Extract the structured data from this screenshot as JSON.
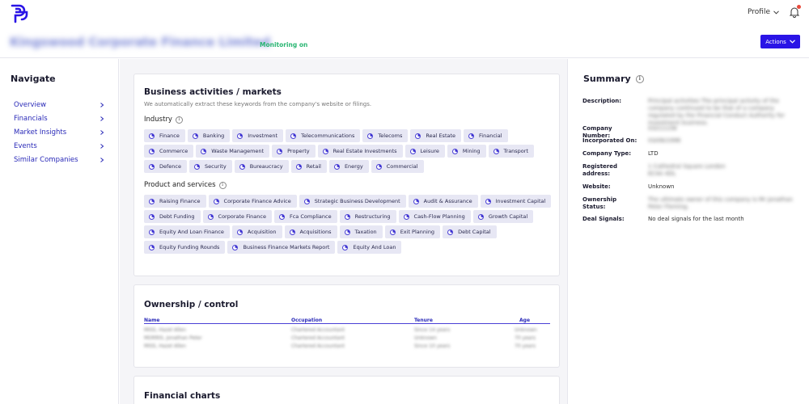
{
  "topbar": {
    "profile_label": "Profile"
  },
  "company": {
    "name": "Kingswood Corporate Finance Limited",
    "monitoring": "Monitoring on",
    "actions_label": "Actions"
  },
  "nav": {
    "title": "Navigate",
    "items": [
      {
        "label": "Overview"
      },
      {
        "label": "Financials"
      },
      {
        "label": "Market Insights"
      },
      {
        "label": "Events"
      },
      {
        "label": "Similar Companies"
      }
    ]
  },
  "business": {
    "title": "Business activities / markets",
    "subtitle": "We automatically extract these keywords from the company's website or filings.",
    "industry_label": "Industry",
    "industry_tags": [
      "Finance",
      "Banking",
      "Investment",
      "Telecommunications",
      "Telecoms",
      "Real Estate",
      "Financial",
      "Commerce",
      "Waste Management",
      "Property",
      "Real Estate Investments",
      "Leisure",
      "Mining",
      "Transport",
      "Defence",
      "Security",
      "Bureaucracy",
      "Retail",
      "Energy",
      "Commercial"
    ],
    "products_label": "Product and services",
    "product_tags": [
      "Raising Finance",
      "Corporate Finance Advice",
      "Strategic Business Development",
      "Audit & Assurance",
      "Investment Capital",
      "Debt Funding",
      "Corporate Finance",
      "Fca Compliance",
      "Restructuring",
      "Cash-Flow Planning",
      "Growth Capital",
      "Equity And Loan Finance",
      "Acquisition",
      "Acquisitions",
      "Taxation",
      "Exit Planning",
      "Debt Capital",
      "Equity Funding Rounds",
      "Business Finance Markets Report",
      "Equity And Loan"
    ]
  },
  "ownership": {
    "title": "Ownership / control",
    "columns": {
      "name": "Name",
      "occupation": "Occupation",
      "tenure": "Tenure",
      "age": "Age"
    },
    "rows": [
      {
        "name": "MISS, Hazel Allen",
        "occupation": "Chartered Accountant",
        "tenure": "Since 14 years",
        "age": "Unknown"
      },
      {
        "name": "MORRIS, Jonathan Peter",
        "occupation": "Chartered Accountant",
        "tenure": "Unknown",
        "age": "70 years"
      },
      {
        "name": "MISS, Hazel Allen",
        "occupation": "Chartered Accountant",
        "tenure": "Since 10 years",
        "age": "70 years"
      }
    ]
  },
  "charts": {
    "title": "Financial charts"
  },
  "summary": {
    "title": "Summary",
    "fields": [
      {
        "label": "Description:",
        "value": "Principal activities The principal activity of the company continued to be that of a company regulated by the Financial Conduct Authority for investment business."
      },
      {
        "label": "Company Number:",
        "value": "03211158"
      },
      {
        "label": "Incorporated On:",
        "value": "03/06/1996"
      },
      {
        "label": "Company Type:",
        "value": "LTD"
      },
      {
        "label": "Registered address:",
        "value": "1 Cathedral Square London EC4A 4DL"
      },
      {
        "label": "Website:",
        "value": "Unknown"
      },
      {
        "label": "Ownership Status:",
        "value": "The ultimate owner of this company is Mr Jonathan Peter Fleming."
      },
      {
        "label": "Deal Signals:",
        "value": "No deal signals for the last month"
      }
    ]
  },
  "colors": {
    "accent": "#2a14e6",
    "monitoring": "#2bb673",
    "nav_link": "#2a2ab8",
    "tag_bg": "#e7e7f4"
  }
}
